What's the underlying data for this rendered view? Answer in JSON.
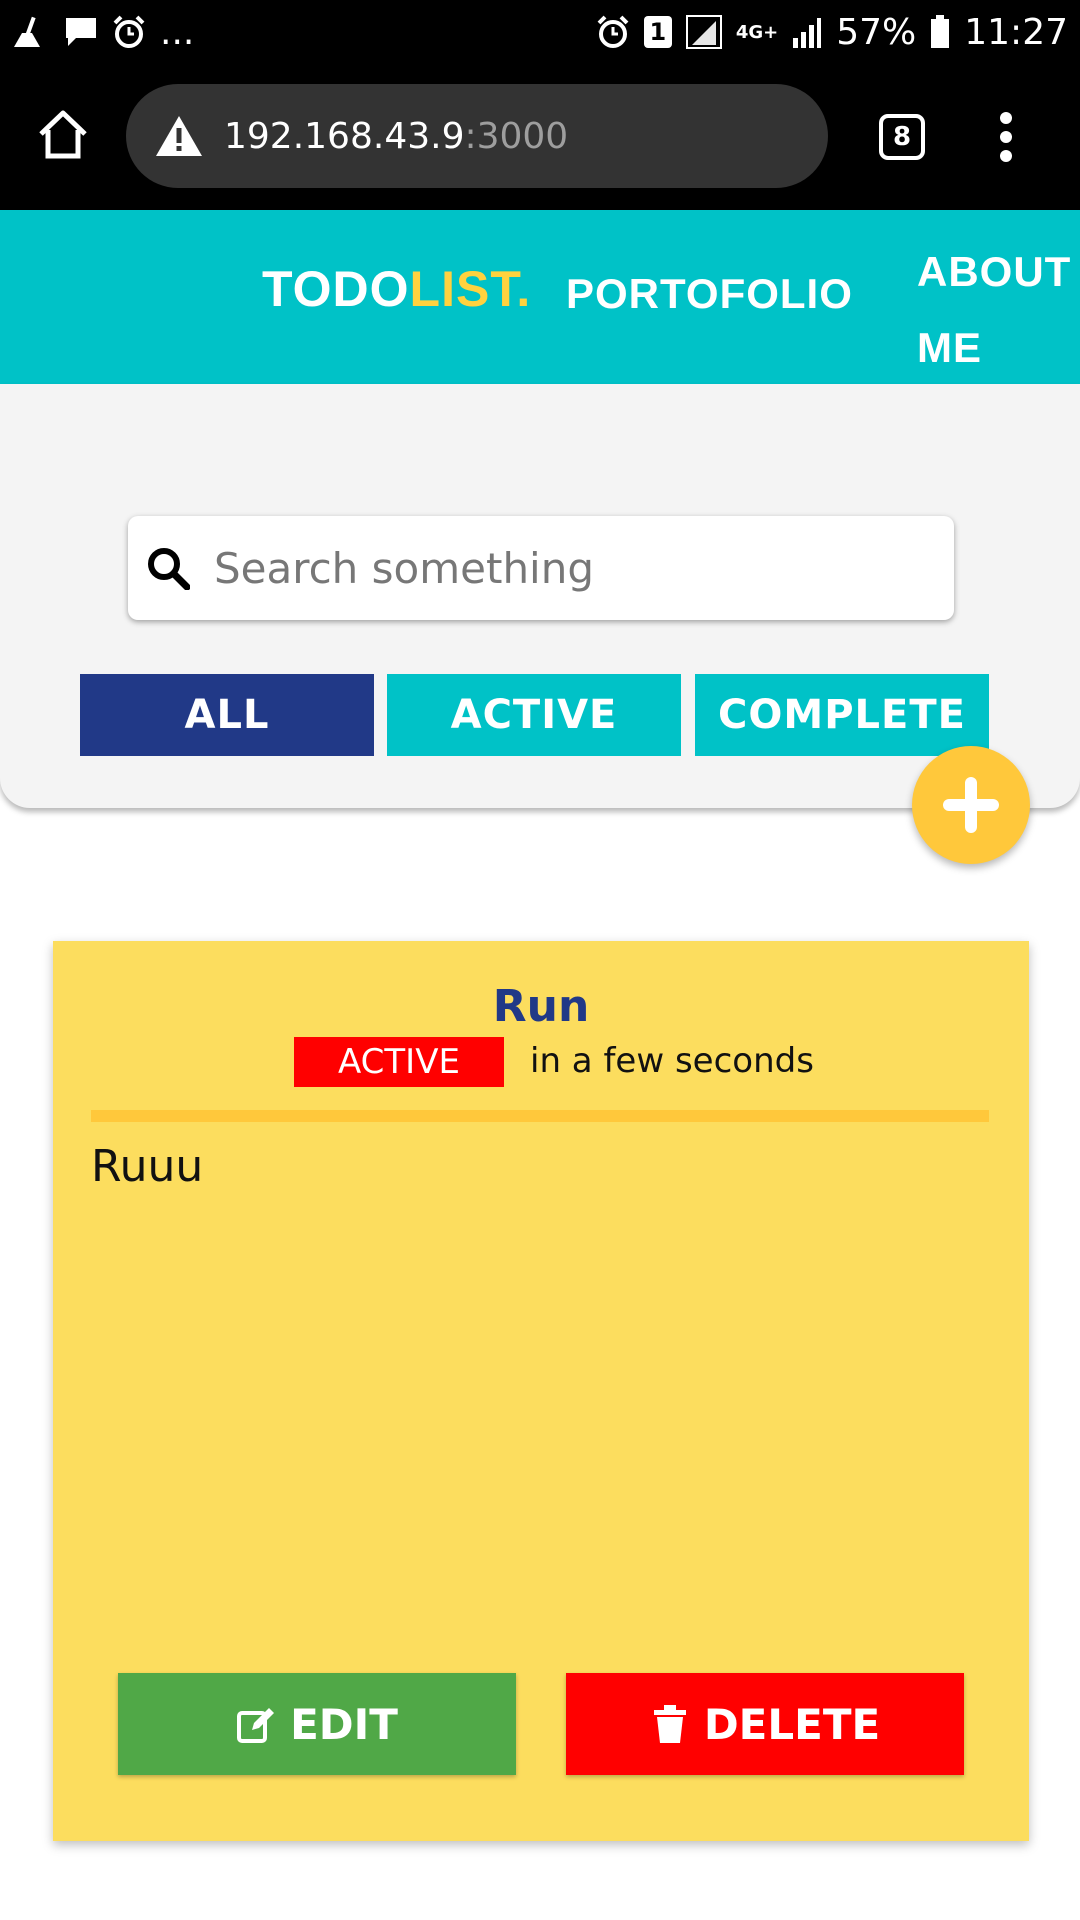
{
  "status_bar": {
    "overflow": "...",
    "battery_percent": "57%",
    "time": "11:27",
    "sim_slot": "1",
    "network_type": "4G+",
    "left_icons": [
      "cleaner-icon",
      "message-icon",
      "alarm-icon"
    ],
    "right_icons": [
      "alarm-icon",
      "sim-icon",
      "signal-icon",
      "signal-icon",
      "battery-icon"
    ]
  },
  "browser": {
    "url_host": "192.168.43.9",
    "url_port": ":3000",
    "tab_count": "8",
    "icons": [
      "home-icon",
      "warning-icon",
      "tabs-icon",
      "more-vert-icon"
    ]
  },
  "navbar": {
    "brand_main": "TODO",
    "brand_accent": "LIST.",
    "portfolio_label": "PORTOFOLIO",
    "about_line1": "ABOUT",
    "about_line2": "ME"
  },
  "search": {
    "placeholder": "Search something",
    "value": ""
  },
  "filters": {
    "all_label": "ALL",
    "active_label": "ACTIVE",
    "complete_label": "COMPLETE",
    "selected": "ALL"
  },
  "todos": [
    {
      "title": "Run",
      "status": "ACTIVE",
      "time": "in a few seconds",
      "description": "Ruuu",
      "edit_label": "EDIT",
      "delete_label": "DELETE"
    }
  ],
  "colors": {
    "navbar": "#00c2c7",
    "brand_accent": "#ffd23f",
    "filter_selected": "#213987",
    "filter_default": "#00c2c7",
    "fab": "#ffc83b",
    "card_bg": "#fcdd5e",
    "status_active": "#ff0000",
    "edit": "#50a847",
    "delete": "#ff0000"
  }
}
